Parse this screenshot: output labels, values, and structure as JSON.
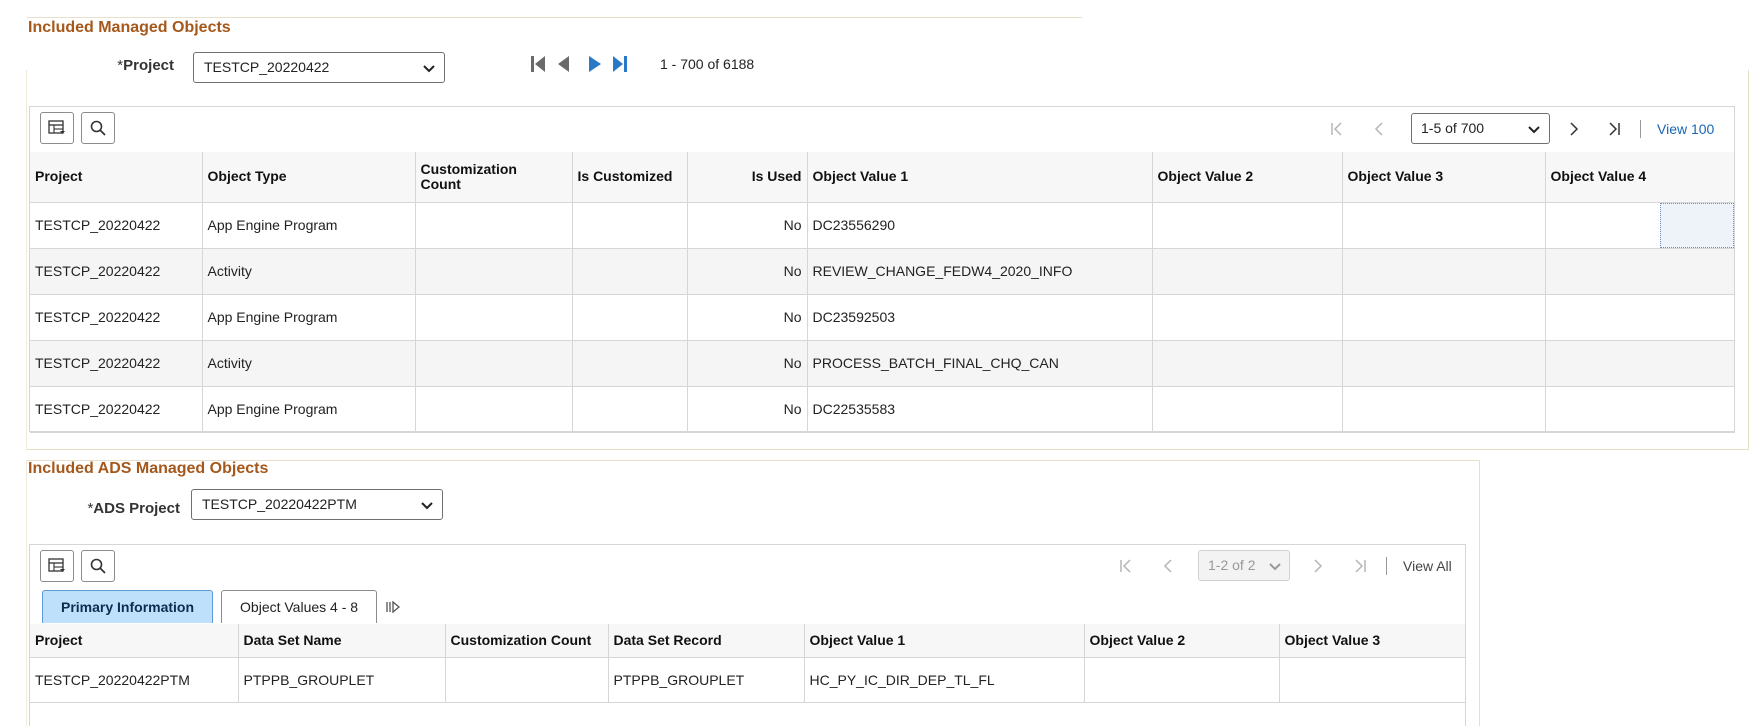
{
  "section1": {
    "title": "Included Managed Objects",
    "project_label_req": "*",
    "project_label": "Project",
    "project_value": "TESTCP_20220422",
    "range_text": "1 - 700 of 6188",
    "grid": {
      "pager_value": "1-5 of 700",
      "view_link": "View 100",
      "columns": [
        "Project",
        "Object Type",
        "Customization Count",
        "Is Customized",
        "Is Used",
        "Object Value 1",
        "Object Value 2",
        "Object Value 3",
        "Object Value 4"
      ],
      "rows": [
        [
          "TESTCP_20220422",
          "App Engine Program",
          "",
          "",
          "No",
          "DC23556290",
          "",
          "",
          ""
        ],
        [
          "TESTCP_20220422",
          "Activity",
          "",
          "",
          "No",
          "REVIEW_CHANGE_FEDW4_2020_INFO",
          "",
          "",
          ""
        ],
        [
          "TESTCP_20220422",
          "App Engine Program",
          "",
          "",
          "No",
          "DC23592503",
          "",
          "",
          ""
        ],
        [
          "TESTCP_20220422",
          "Activity",
          "",
          "",
          "No",
          "PROCESS_BATCH_FINAL_CHQ_CAN",
          "",
          "",
          ""
        ],
        [
          "TESTCP_20220422",
          "App Engine Program",
          "",
          "",
          "No",
          "DC22535583",
          "",
          "",
          ""
        ]
      ]
    }
  },
  "section2": {
    "title": "Included ADS Managed Objects",
    "project_label_req": "*",
    "project_label": "ADS Project",
    "project_value": "TESTCP_20220422PTM",
    "grid": {
      "pager_value": "1-2 of 2",
      "view_link": "View All",
      "tabs": [
        "Primary Information",
        "Object Values 4 - 8"
      ],
      "columns": [
        "Project",
        "Data Set Name",
        "Customization Count",
        "Data Set Record",
        "Object Value 1",
        "Object Value 2",
        "Object Value 3"
      ],
      "rows": [
        [
          "TESTCP_20220422PTM",
          "PTPPB_GROUPLET",
          "",
          "PTPPB_GROUPLET",
          "HC_PY_IC_DIR_DEP_TL_FL",
          "",
          ""
        ]
      ]
    }
  },
  "colors": {
    "section_title": "#a5581b",
    "link": "#1a66b5",
    "active_tab": "#bfe0fb",
    "nav_blue": "#2b78c6"
  },
  "icons": [
    "grid-personalize-icon",
    "search-icon",
    "first-page-icon",
    "previous-page-icon",
    "next-page-icon",
    "last-page-icon",
    "chevron-down-icon",
    "show-all-columns-icon"
  ]
}
